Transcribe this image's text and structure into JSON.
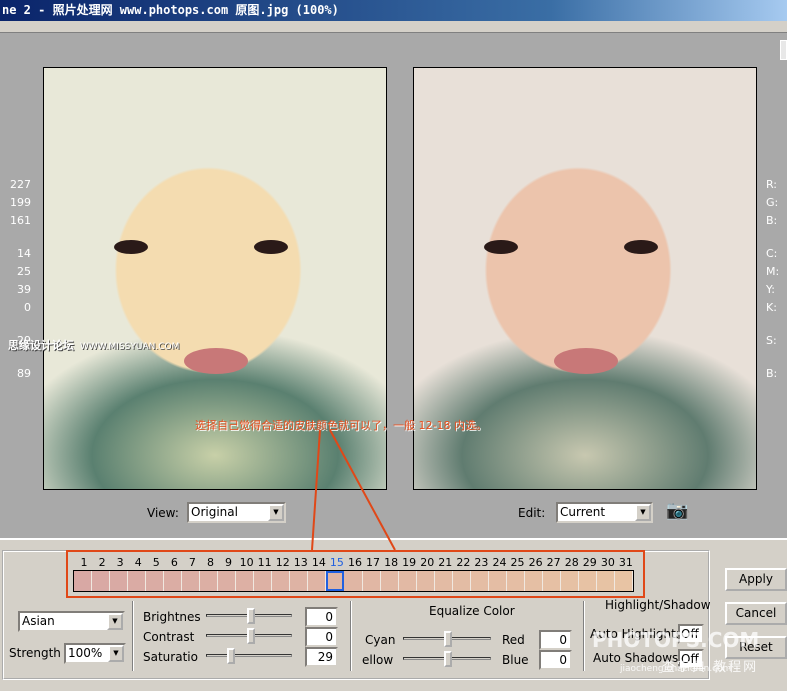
{
  "window": {
    "title": "ne 2 - 照片处理网 www.photops.com 原图.jpg (100%)"
  },
  "readout": {
    "values": [
      "227",
      "199",
      "161",
      "14",
      "25",
      "39",
      "0",
      "29",
      "89"
    ],
    "labels": [
      "R:",
      "G:",
      "B:",
      "C:",
      "M:",
      "Y:",
      "K:",
      "S:",
      "B:"
    ]
  },
  "watermark_left": {
    "cn": "思缘设计论坛",
    "url": "WWW.MISSYUAN.COM"
  },
  "annotation": {
    "text": "选择自己觉得合适的皮肤颜色就可以了，一般 12-18 内选。",
    "color": "#e04818"
  },
  "view": {
    "label": "View:",
    "value": "Original"
  },
  "edit": {
    "label": "Edit:",
    "value": "Current"
  },
  "snapshot_icon": "camera-icon",
  "swatches": {
    "numbers": [
      "1",
      "2",
      "3",
      "4",
      "5",
      "6",
      "7",
      "8",
      "9",
      "10",
      "11",
      "12",
      "13",
      "14",
      "15",
      "16",
      "17",
      "18",
      "19",
      "20",
      "21",
      "22",
      "23",
      "24",
      "25",
      "26",
      "27",
      "28",
      "29",
      "30",
      "31"
    ],
    "selected": "15",
    "color_start": "#d8a8a4",
    "color_end": "#e8c4a4",
    "selected_color": "#2060e0"
  },
  "skin": {
    "type": "Asian",
    "strength_label": "Strength",
    "strength": "100%"
  },
  "adjust": {
    "brightness_label": "Brightnes",
    "brightness": "0",
    "contrast_label": "Contrast",
    "contrast": "0",
    "saturation_label": "Saturatio",
    "saturation": "29"
  },
  "equalize": {
    "title": "Equalize Color",
    "cyan": "Cyan",
    "red": "Red",
    "red_value": "0",
    "yellow": "ellow",
    "blue": "Blue",
    "blue_value": "0"
  },
  "highlight": {
    "title": "Highlight/Shadow",
    "auto_highlights": "Auto Highlights",
    "auto_highlights_value": "Off",
    "auto_shadows": "Auto Shadows",
    "auto_shadows_value": "Off"
  },
  "buttons": {
    "apply": "Apply",
    "cancel": "Cancel",
    "reset": "Reset"
  },
  "watermark_right": {
    "brand": "PHOTOPS.COM",
    "cn": "查字典 教程网",
    "url": "jiaocheng.chazidian.com"
  }
}
